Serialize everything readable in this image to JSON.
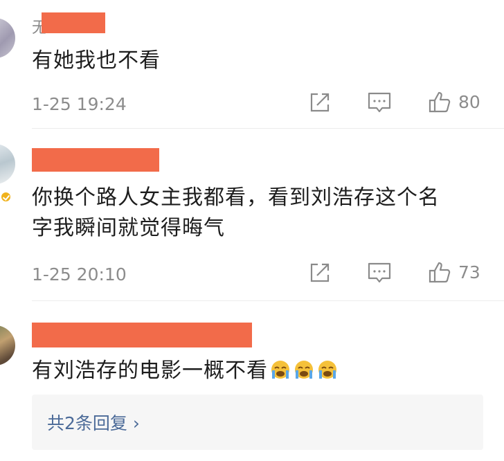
{
  "comments": [
    {
      "name_hint": "无",
      "text_lines": [
        "有她我也不看"
      ],
      "time": "1-25 19:24",
      "likes": "80",
      "verified": false
    },
    {
      "name_hint": "",
      "text_lines": [
        "你换个路人女主我都看，看到刘浩存这个名",
        "字我瞬间就觉得晦气"
      ],
      "time": "1-25 20:10",
      "likes": "73",
      "verified": true
    },
    {
      "name_hint": "",
      "text_lines": [
        "有刘浩存的电影一概不看"
      ],
      "emojis": [
        "crying-face",
        "crying-face",
        "crying-face"
      ],
      "time": "",
      "likes": "",
      "verified": false
    }
  ],
  "replies": {
    "label": "共2条回复 ›"
  },
  "icons": {
    "share": "share-icon",
    "comment": "comment-icon",
    "like": "thumbs-up-icon"
  },
  "colors": {
    "redaction": "#f26b4a",
    "link": "#4b6a98",
    "muted": "#8c8c8c",
    "emoji": "#f5c13a"
  }
}
